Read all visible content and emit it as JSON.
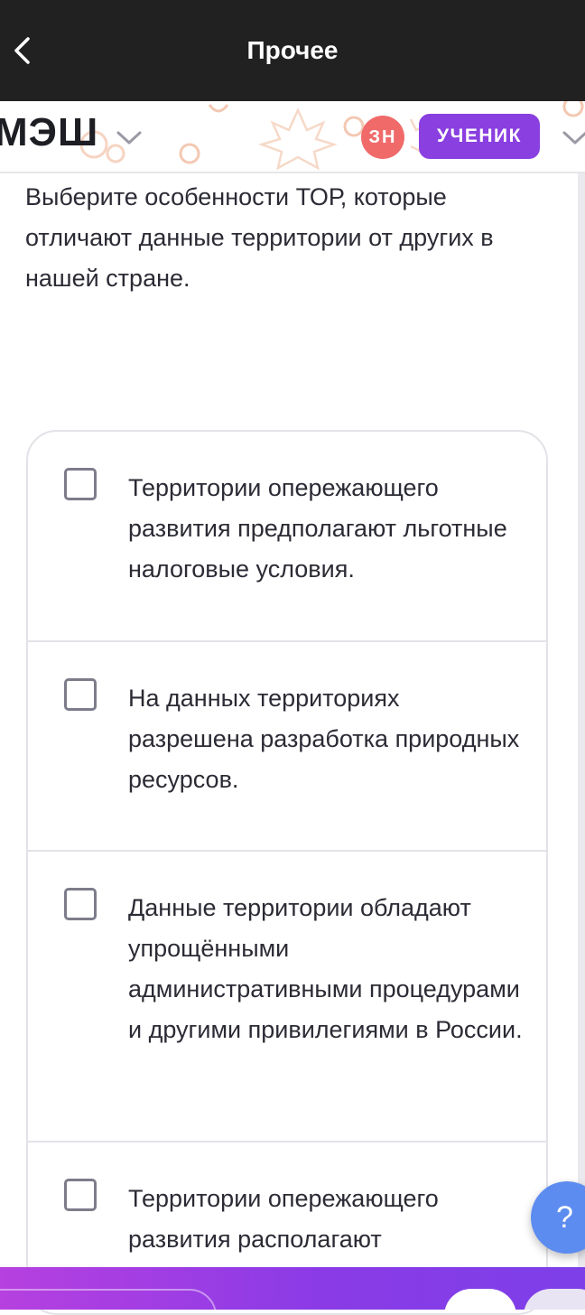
{
  "topbar": {
    "title": "Прочее"
  },
  "appbar": {
    "logo": "МЭШ",
    "avatar_initials": "ЗН",
    "role": "УЧЕНИК",
    "avatar_color": "#f06a6a",
    "role_color": "#8a3fe0"
  },
  "question": {
    "text": "Выберите особенности ТОР, которые отличают данные территории от других в нашей стране."
  },
  "options": [
    {
      "label": "Территории опережающего развития предполагают льготные налоговые условия.",
      "checked": false
    },
    {
      "label": "На данных территориях разрешена разработка природных ресурсов.",
      "checked": false
    },
    {
      "label": "Данные территории обладают упрощёнными административными процедурами и другими привилегиями в России.",
      "checked": false
    },
    {
      "label": "Территории опережающего развития располагают",
      "checked": false
    }
  ],
  "help": {
    "label": "?"
  },
  "colors": {
    "accent": "#8a3be6",
    "help": "#5c8cf0",
    "topbar": "#212121"
  }
}
